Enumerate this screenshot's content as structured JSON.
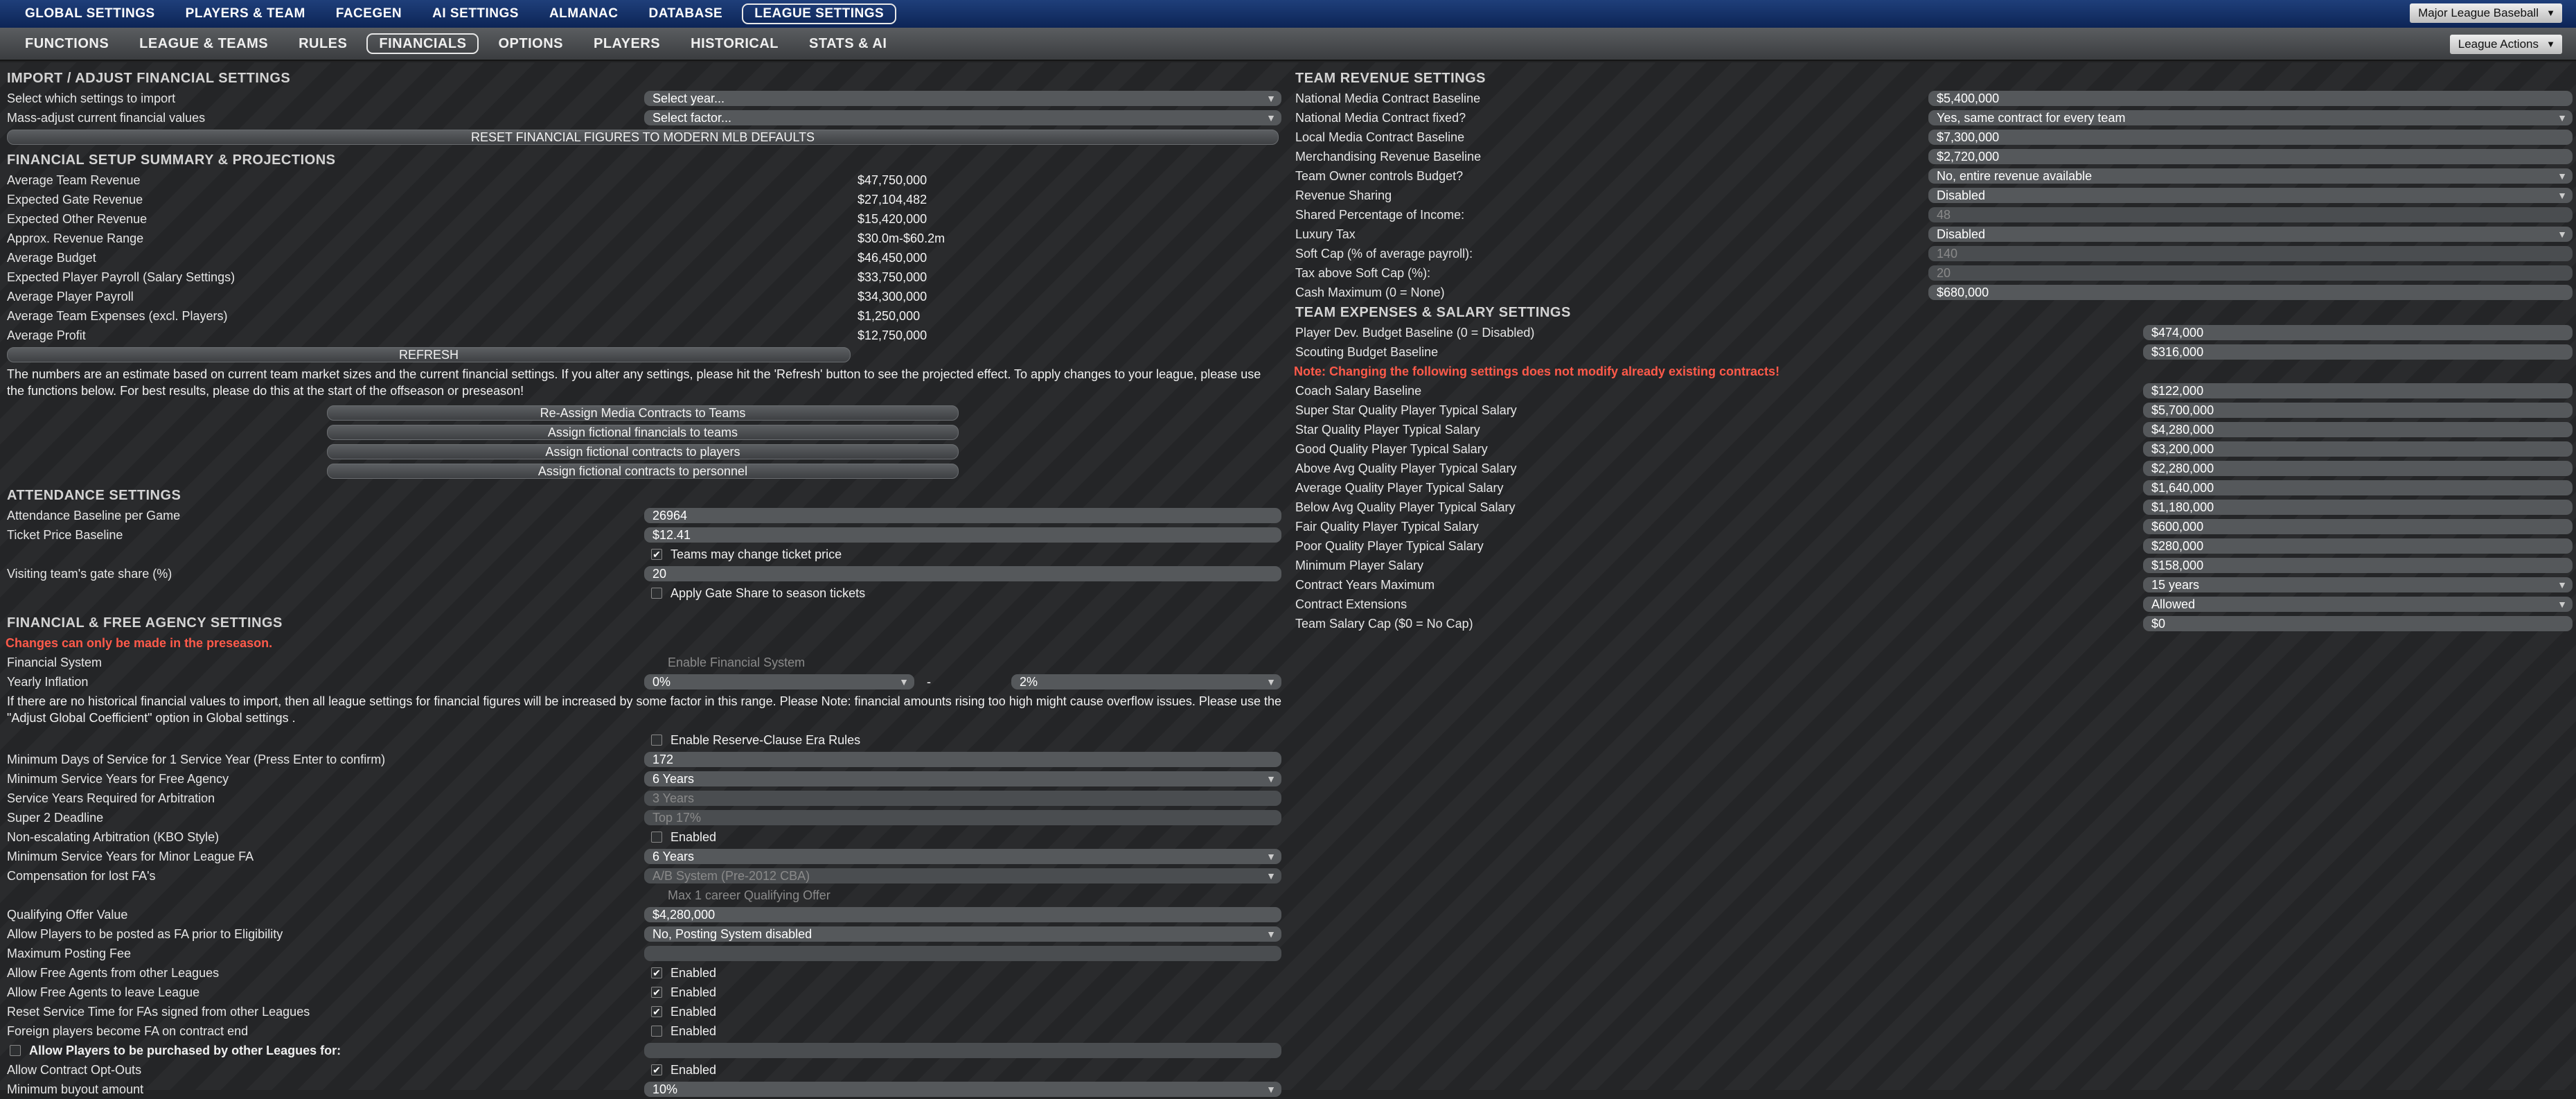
{
  "topnav": {
    "items": [
      "GLOBAL SETTINGS",
      "PLAYERS & TEAM",
      "FACEGEN",
      "AI SETTINGS",
      "ALMANAC",
      "DATABASE",
      "LEAGUE SETTINGS"
    ],
    "league": "Major League Baseball"
  },
  "subnav": {
    "items": [
      "FUNCTIONS",
      "LEAGUE & TEAMS",
      "RULES",
      "FINANCIALS",
      "OPTIONS",
      "PLAYERS",
      "HISTORICAL",
      "STATS & AI"
    ],
    "actions": "League Actions"
  },
  "import": {
    "title": "IMPORT / ADJUST FINANCIAL SETTINGS",
    "select_label": "Select which settings to import",
    "select_value": "Select year...",
    "mass_label": "Mass-adjust current financial values",
    "mass_value": "Select factor...",
    "reset_btn": "RESET FINANCIAL FIGURES TO MODERN MLB DEFAULTS"
  },
  "summary": {
    "title": "FINANCIAL SETUP SUMMARY & PROJECTIONS",
    "rows": [
      [
        "Average Team Revenue",
        "$47,750,000"
      ],
      [
        "Expected Gate Revenue",
        "$27,104,482"
      ],
      [
        "Expected Other Revenue",
        "$15,420,000"
      ],
      [
        "Approx. Revenue Range",
        "$30.0m-$60.2m"
      ],
      [
        "Average Budget",
        "$46,450,000"
      ],
      [
        "Expected Player Payroll (Salary Settings)",
        "$33,750,000"
      ],
      [
        "Average Player Payroll",
        "$34,300,000"
      ],
      [
        "Average Team Expenses (excl. Players)",
        "$1,250,000"
      ],
      [
        "Average Profit",
        "$12,750,000"
      ]
    ],
    "refresh": "REFRESH",
    "note": "The numbers are an estimate based on current team market sizes and the current financial settings. If you alter any settings, please hit the 'Refresh' button to see the projected effect. To apply changes to your league, please use the functions below. For best results, please do this at the start of the offseason or preseason!",
    "buttons": [
      "Re-Assign Media Contracts to Teams",
      "Assign fictional financials to teams",
      "Assign fictional contracts to players",
      "Assign fictional contracts to personnel"
    ]
  },
  "attendance": {
    "title": "ATTENDANCE SETTINGS",
    "baseline_label": "Attendance Baseline per Game",
    "baseline": "26964",
    "ticket_label": "Ticket Price Baseline",
    "ticket": "$12.41",
    "teams_change": "Teams may change ticket price",
    "gate_label": "Visiting team's gate share (%)",
    "gate": "20",
    "apply_gate": "Apply Gate Share to season tickets"
  },
  "fa": {
    "title": "FINANCIAL & FREE AGENCY SETTINGS",
    "warning": "Changes can only be made in the preseason.",
    "fin_sys_label": "Financial System",
    "fin_sys": "Enable Financial System",
    "inflation_label": "Yearly Inflation",
    "infl_from": "0%",
    "dash": "-",
    "infl_to": "2%",
    "note": "If there are no historical financial values to import, then all league settings for financial figures will be increased by some factor in this range. Please Note: financial amounts rising too high might cause overflow issues. Please use the \"Adjust Global Coefficient\" option in Global settings .",
    "reserve": "Enable Reserve-Clause Era Rules",
    "rows": [
      {
        "label": "Minimum Days of Service for 1 Service Year (Press Enter to confirm)",
        "value": "172",
        "type": "field"
      },
      {
        "label": "Minimum Service Years for Free Agency",
        "value": "6 Years",
        "type": "drop"
      },
      {
        "label": "Service Years Required for Arbitration",
        "value": "3 Years",
        "type": "dis"
      },
      {
        "label": "Super 2 Deadline",
        "value": "Top 17%",
        "type": "dis"
      },
      {
        "label": "Non-escalating Arbitration (KBO Style)",
        "value": "Enabled",
        "type": "cb",
        "checked": false
      },
      {
        "label": "Minimum Service Years for Minor League FA",
        "value": "6 Years",
        "type": "drop"
      },
      {
        "label": "Compensation for lost FA's",
        "value": "A/B System (Pre-2012 CBA)",
        "type": "disdrop"
      },
      {
        "label": "",
        "value": "Max 1 career Qualifying Offer",
        "type": "distext"
      },
      {
        "label": "Qualifying Offer Value",
        "value": "$4,280,000",
        "type": "field"
      },
      {
        "label": "Allow Players to be posted as FA prior to Eligibility",
        "value": "No, Posting System disabled",
        "type": "drop"
      },
      {
        "label": "Maximum Posting Fee",
        "value": "",
        "type": "dis"
      },
      {
        "label": "Allow Free Agents from other Leagues",
        "value": "Enabled",
        "type": "cb",
        "checked": true
      },
      {
        "label": "Allow Free Agents to leave League",
        "value": "Enabled",
        "type": "cb",
        "checked": true
      },
      {
        "label": "Reset Service Time for FAs signed from other Leagues",
        "value": "Enabled",
        "type": "cb",
        "checked": true
      },
      {
        "label": "Foreign players become FA on contract end",
        "value": "Enabled",
        "type": "cb",
        "checked": false
      },
      {
        "label": "Allow Players to be purchased by other Leagues for:",
        "value": "",
        "type": "cbleft"
      },
      {
        "label": "Allow Contract Opt-Outs",
        "value": "Enabled",
        "type": "cb",
        "checked": true
      },
      {
        "label": "Minimum buyout amount",
        "value": "10%",
        "type": "drop"
      }
    ]
  },
  "revenue": {
    "title": "TEAM REVENUE SETTINGS",
    "rows": [
      {
        "label": "National Media Contract Baseline",
        "value": "$5,400,000",
        "type": "field"
      },
      {
        "label": "National Media Contract fixed?",
        "value": "Yes, same contract for every team",
        "type": "drop"
      },
      {
        "label": "Local Media Contract Baseline",
        "value": "$7,300,000",
        "type": "field"
      },
      {
        "label": "Merchandising Revenue Baseline",
        "value": "$2,720,000",
        "type": "field"
      },
      {
        "label": "Team Owner controls Budget?",
        "value": "No, entire revenue available",
        "type": "drop"
      },
      {
        "label": "Revenue Sharing",
        "value": "Disabled",
        "type": "drop"
      },
      {
        "label": "Shared Percentage of Income:",
        "value": "48",
        "type": "dis"
      },
      {
        "label": "Luxury Tax",
        "value": "Disabled",
        "type": "drop"
      },
      {
        "label": "Soft Cap (% of average payroll):",
        "value": "140",
        "type": "dis"
      },
      {
        "label": "Tax above Soft Cap (%):",
        "value": "20",
        "type": "dis"
      },
      {
        "label": "Cash Maximum (0 = None)",
        "value": "$680,000",
        "type": "field"
      }
    ]
  },
  "expenses": {
    "title": "TEAM EXPENSES & SALARY SETTINGS",
    "note": "Note: Changing the following settings does not modify already existing contracts!",
    "rows_top": [
      {
        "label": "Player Dev. Budget Baseline (0 = Disabled)",
        "value": "$474,000",
        "type": "field"
      },
      {
        "label": "Scouting Budget Baseline",
        "value": "$316,000",
        "type": "field"
      }
    ],
    "rows": [
      {
        "label": "Coach Salary Baseline",
        "value": "$122,000",
        "type": "field"
      },
      {
        "label": "Super Star Quality Player Typical Salary",
        "value": "$5,700,000",
        "type": "field"
      },
      {
        "label": "Star Quality Player Typical Salary",
        "value": "$4,280,000",
        "type": "field"
      },
      {
        "label": "Good Quality Player Typical Salary",
        "value": "$3,200,000",
        "type": "field"
      },
      {
        "label": "Above Avg Quality Player Typical Salary",
        "value": "$2,280,000",
        "type": "field"
      },
      {
        "label": "Average Quality Player Typical Salary",
        "value": "$1,640,000",
        "type": "field"
      },
      {
        "label": "Below Avg Quality Player Typical Salary",
        "value": "$1,180,000",
        "type": "field"
      },
      {
        "label": "Fair Quality Player Typical Salary",
        "value": "$600,000",
        "type": "field"
      },
      {
        "label": "Poor Quality Player Typical Salary",
        "value": "$280,000",
        "type": "field"
      },
      {
        "label": "Minimum Player Salary",
        "value": "$158,000",
        "type": "field"
      },
      {
        "label": "Contract Years Maximum",
        "value": "15 years",
        "type": "drop"
      },
      {
        "label": "Contract Extensions",
        "value": "Allowed",
        "type": "drop"
      },
      {
        "label": "Team Salary Cap ($0 = No Cap)",
        "value": "$0",
        "type": "field"
      }
    ]
  }
}
